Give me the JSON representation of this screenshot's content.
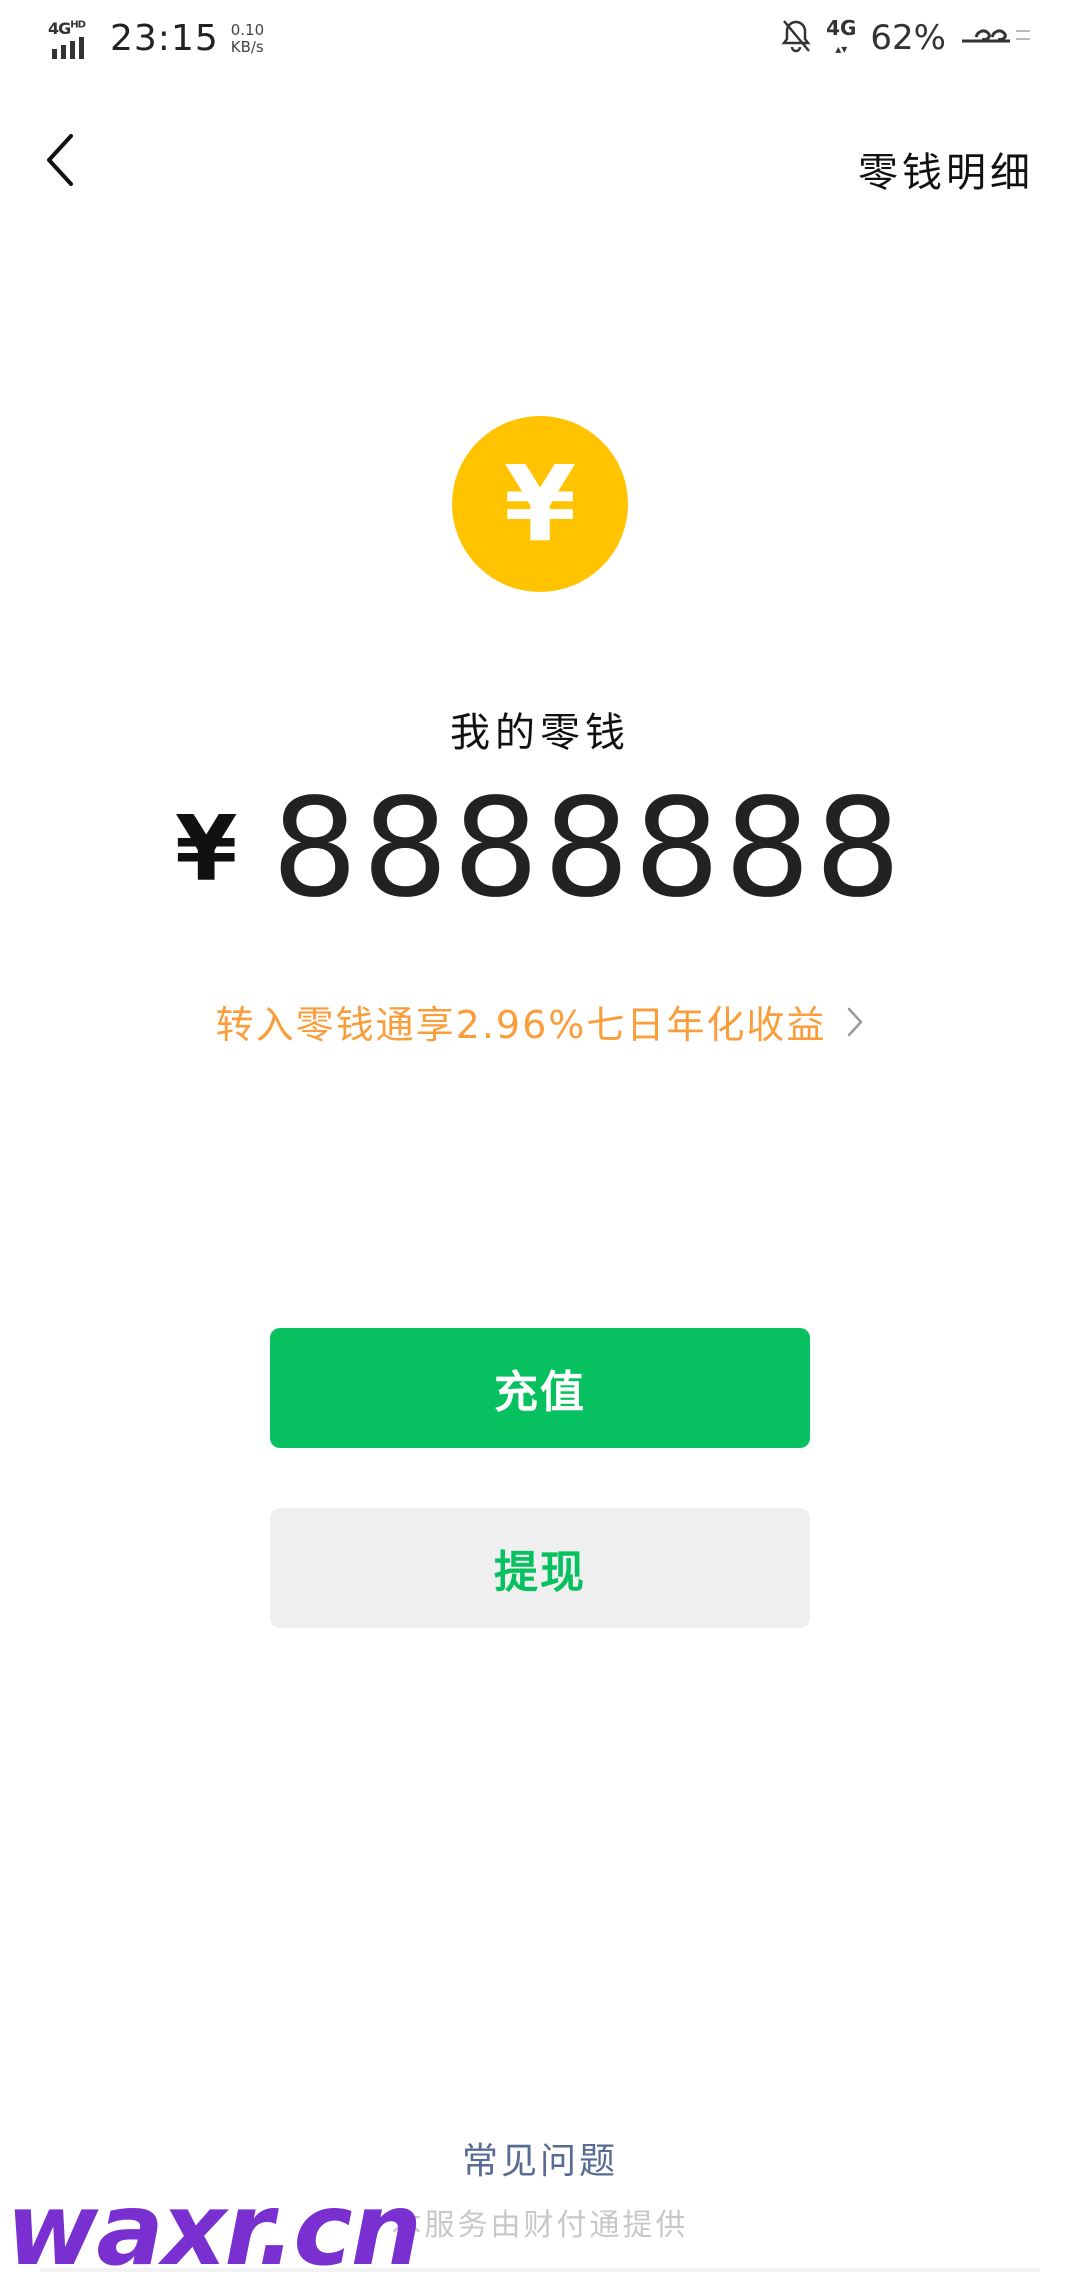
{
  "status_bar": {
    "network_type": "4G",
    "network_hd": "HD",
    "time": "23:15",
    "speed_value": "0.10",
    "speed_unit": "KB/s",
    "network_right": "4G",
    "battery": "62%"
  },
  "header": {
    "details_label": "零钱明细"
  },
  "wallet": {
    "title": "我的零钱",
    "currency_symbol": "¥",
    "amount": "8888888",
    "promo_text": "转入零钱通享2.96%七日年化收益"
  },
  "actions": {
    "recharge_label": "充值",
    "withdraw_label": "提现"
  },
  "footer": {
    "faq_label": "常见问题",
    "provider_text": "本服务由财付通提供"
  },
  "watermark": {
    "text": "waxr.cn"
  },
  "colors": {
    "primary_green": "#07c160",
    "coin_yellow": "#ffc300",
    "promo_orange": "#fa9d3b",
    "link_blue": "#576b95",
    "watermark_purple": "#7a2fd0"
  },
  "icons": {
    "back": "chevron-left-icon",
    "promo_arrow": "chevron-right-icon",
    "coin": "yuan-coin-icon",
    "mute": "bell-off-icon",
    "signal": "signal-icon"
  }
}
